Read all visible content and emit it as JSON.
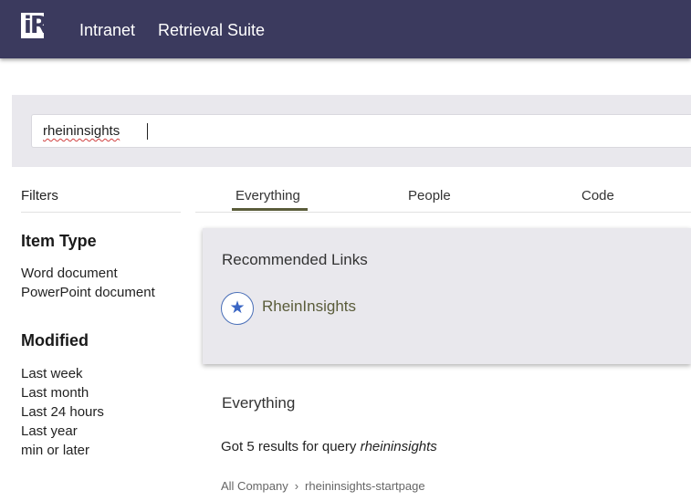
{
  "header": {
    "logo_icon": "rheininsights-logo-icon",
    "nav": [
      {
        "label": "Intranet"
      },
      {
        "label": "Retrieval Suite"
      }
    ],
    "background": "#3b3a5e"
  },
  "search": {
    "value": "rheininsights"
  },
  "filters": {
    "title": "Filters",
    "groups": [
      {
        "title": "Item Type",
        "items": [
          "Word document",
          "PowerPoint document"
        ]
      },
      {
        "title": "Modified",
        "items": [
          "Last week",
          "Last month",
          "Last 24 hours",
          "Last year",
          "min or later"
        ]
      }
    ]
  },
  "tabs": {
    "items": [
      {
        "label": "Everything",
        "active": true
      },
      {
        "label": "People",
        "active": false
      },
      {
        "label": "Code",
        "active": false
      }
    ],
    "accent": "#5a5c3a"
  },
  "recommended": {
    "title": "Recommended Links",
    "links": [
      {
        "icon": "star-icon",
        "label": "RheinInsights"
      }
    ]
  },
  "results": {
    "heading": "Everything",
    "summary_prefix": "Got 5 results for query ",
    "summary_query": "rheininsights",
    "first_result": {
      "breadcrumb": [
        "All Company",
        "rheininsights-startpage"
      ]
    }
  }
}
